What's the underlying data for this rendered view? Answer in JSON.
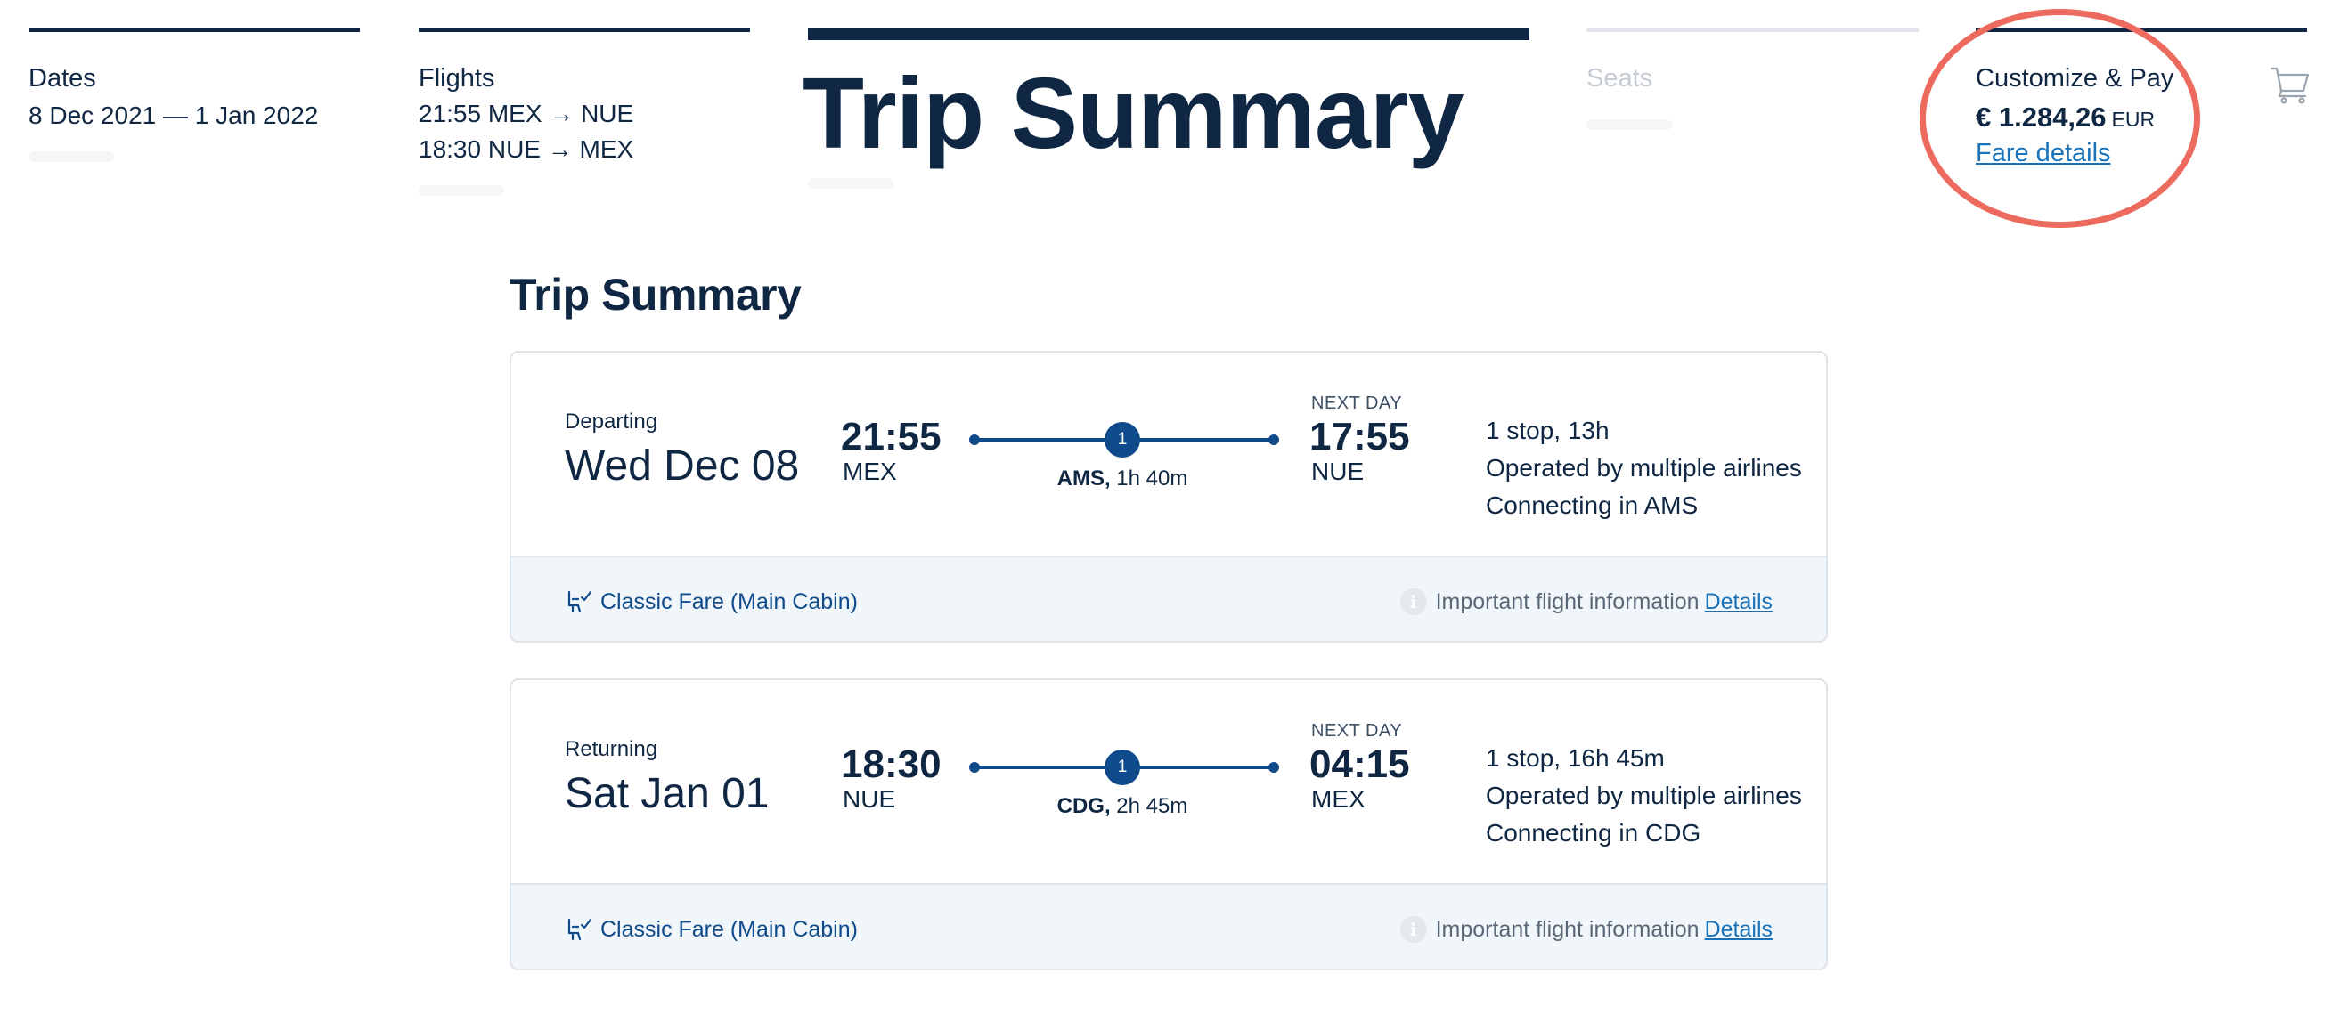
{
  "nav": {
    "dates": {
      "title": "Dates",
      "range": "8 Dec 2021 — 1 Jan 2022"
    },
    "flights": {
      "title": "Flights",
      "outbound": "21:55 MEX → NUE",
      "return": "18:30 NUE → MEX"
    },
    "trip_summary": {
      "title": "Trip Summary"
    },
    "seats": {
      "title": "Seats"
    },
    "customize_pay": {
      "title": "Customize & Pay",
      "amount": "€ 1.284,26",
      "currency": "EUR",
      "fare_details_link": "Fare details"
    },
    "cart_icon": "shopping-cart-icon"
  },
  "main": {
    "title": "Trip Summary",
    "trips": [
      {
        "direction": "Departing",
        "date": "Wed Dec 08",
        "depart_time": "21:55",
        "depart_code": "MEX",
        "arrive_time": "17:55",
        "arrive_code": "NUE",
        "next_day": "NEXT DAY",
        "stops_badge": "1",
        "layover_code": "AMS,",
        "layover_duration": "1h 40m",
        "summary_stops": "1 stop, 13h",
        "summary_operated": "Operated by multiple airlines",
        "summary_connecting": "Connecting in AMS",
        "fare": "Classic Fare (Main Cabin)",
        "info_text": "Important flight information",
        "details_link": "Details"
      },
      {
        "direction": "Returning",
        "date": "Sat Jan 01",
        "depart_time": "18:30",
        "depart_code": "NUE",
        "arrive_time": "04:15",
        "arrive_code": "MEX",
        "next_day": "NEXT DAY",
        "stops_badge": "1",
        "layover_code": "CDG,",
        "layover_duration": "2h 45m",
        "summary_stops": "1 stop, 16h 45m",
        "summary_operated": "Operated by multiple airlines",
        "summary_connecting": "Connecting in CDG",
        "fare": "Classic Fare (Main Cabin)",
        "info_text": "Important flight information",
        "details_link": "Details"
      }
    ]
  },
  "colors": {
    "navy": "#0f2742",
    "route_blue": "#0f4a8a",
    "link_blue": "#1a73b8",
    "highlight_ring": "#ec6b5e",
    "footer_bg": "#f1f6fb"
  }
}
